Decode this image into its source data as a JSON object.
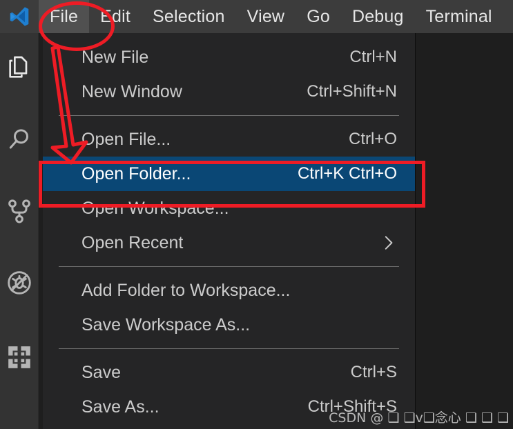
{
  "app": {
    "name": "Visual Studio Code",
    "logo_icon": "vscode-logo-icon",
    "colors": {
      "titlebar_bg": "#3c3c3c",
      "menu_bg": "#252526",
      "editor_bg": "#1e1e1e",
      "activitybar_bg": "#333333",
      "selection_blue": "#0a4775",
      "annotation_red": "#ee1c25",
      "text": "#cccccc"
    }
  },
  "menubar": {
    "items": [
      {
        "label": "File",
        "active": true
      },
      {
        "label": "Edit",
        "active": false
      },
      {
        "label": "Selection",
        "active": false
      },
      {
        "label": "View",
        "active": false
      },
      {
        "label": "Go",
        "active": false
      },
      {
        "label": "Debug",
        "active": false
      },
      {
        "label": "Terminal",
        "active": false
      }
    ]
  },
  "activitybar": {
    "items": [
      {
        "name": "explorer",
        "icon": "files-icon",
        "title": "Explorer"
      },
      {
        "name": "search",
        "icon": "search-icon",
        "title": "Search"
      },
      {
        "name": "source-control",
        "icon": "source-control-icon",
        "title": "Source Control"
      },
      {
        "name": "debug",
        "icon": "debug-icon",
        "title": "Debug"
      },
      {
        "name": "extensions",
        "icon": "extensions-icon",
        "title": "Extensions"
      }
    ]
  },
  "file_menu": {
    "groups": [
      {
        "rows": [
          {
            "label": "New File",
            "accel": "Ctrl+N",
            "selected": false,
            "submenu": false
          },
          {
            "label": "New Window",
            "accel": "Ctrl+Shift+N",
            "selected": false,
            "submenu": false
          }
        ]
      },
      {
        "rows": [
          {
            "label": "Open File...",
            "accel": "Ctrl+O",
            "selected": false,
            "submenu": false
          },
          {
            "label": "Open Folder...",
            "accel": "Ctrl+K Ctrl+O",
            "selected": true,
            "submenu": false
          },
          {
            "label": "Open Workspace...",
            "accel": "",
            "selected": false,
            "submenu": false
          },
          {
            "label": "Open Recent",
            "accel": "",
            "selected": false,
            "submenu": true
          }
        ]
      },
      {
        "rows": [
          {
            "label": "Add Folder to Workspace...",
            "accel": "",
            "selected": false,
            "submenu": false
          },
          {
            "label": "Save Workspace As...",
            "accel": "",
            "selected": false,
            "submenu": false
          }
        ]
      },
      {
        "rows": [
          {
            "label": "Save",
            "accel": "Ctrl+S",
            "selected": false,
            "submenu": false
          },
          {
            "label": "Save As...",
            "accel": "Ctrl+Shift+S",
            "selected": false,
            "submenu": false
          }
        ]
      }
    ]
  },
  "annotations": {
    "ellipse_target": "File",
    "rectangle_target": "Open Folder...",
    "arrow_from": "File",
    "arrow_to": "Open Folder..."
  },
  "watermark": {
    "text": "CSDN @ ❑ ❑v❑念心 ❑ ❑ ❑"
  }
}
